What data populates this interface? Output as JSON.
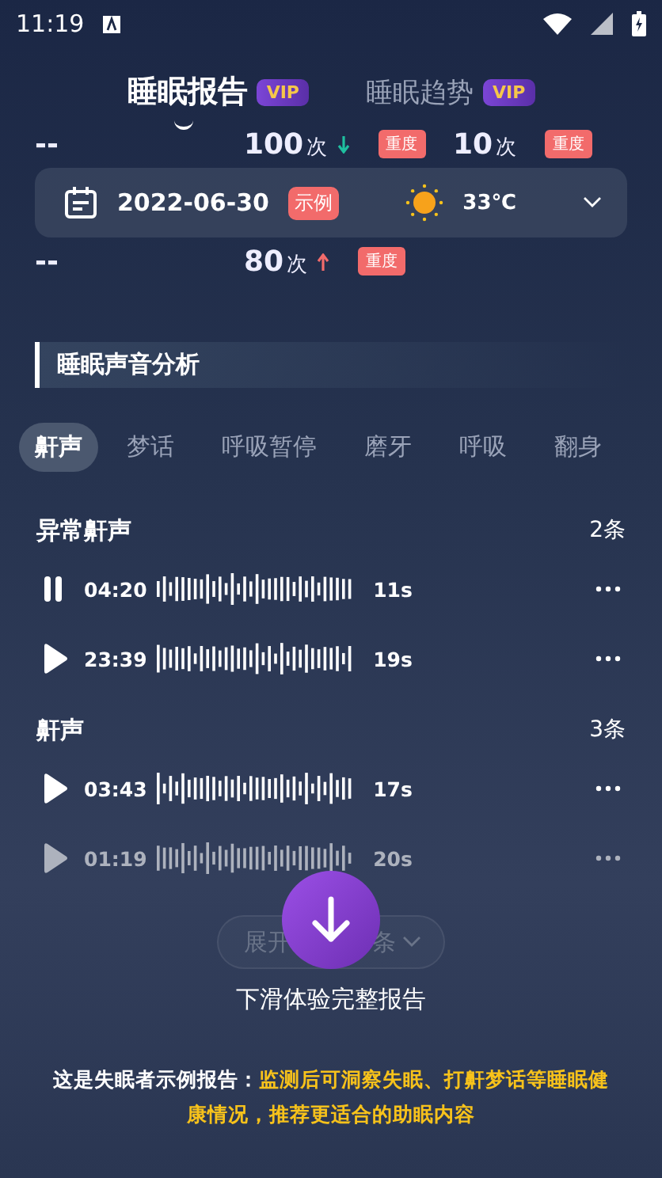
{
  "status_bar": {
    "time": "11:19"
  },
  "tabs": [
    {
      "label": "睡眠报告",
      "badge": "VIP",
      "selected": true
    },
    {
      "label": "睡眠趋势",
      "badge": "VIP",
      "selected": false
    }
  ],
  "stats_rows": [
    {
      "cells": [
        {
          "value": "--"
        },
        {
          "value": "100",
          "unit": "次",
          "increase": false,
          "severity": "重度"
        },
        {
          "value": "10",
          "unit": "次",
          "severity": "重度"
        }
      ]
    },
    {
      "cells": [
        {
          "value": "--"
        },
        {
          "value": "80",
          "unit": "次",
          "increase": true,
          "severity": "重度"
        }
      ]
    }
  ],
  "date_bar": {
    "date": "2022-06-30",
    "tag": "示例",
    "temperature": "33℃"
  },
  "section_title": "睡眠声音分析",
  "categories": [
    {
      "label": "鼾声",
      "selected": true
    },
    {
      "label": "梦话",
      "selected": false
    },
    {
      "label": "呼吸暂停",
      "selected": false
    },
    {
      "label": "磨牙",
      "selected": false
    },
    {
      "label": "呼吸",
      "selected": false
    },
    {
      "label": "翻身",
      "selected": false
    }
  ],
  "groups": [
    {
      "title": "异常鼾声",
      "count": "2条",
      "recordings": [
        {
          "time": "04:20",
          "duration": "11s",
          "playing": true,
          "dimmed": false
        },
        {
          "time": "23:39",
          "duration": "19s",
          "playing": false,
          "dimmed": false
        }
      ]
    },
    {
      "title": "鼾声",
      "count": "3条",
      "recordings": [
        {
          "time": "03:43",
          "duration": "17s",
          "playing": false,
          "dimmed": false
        },
        {
          "time": "01:19",
          "duration": "20s",
          "playing": false,
          "dimmed": true
        }
      ]
    }
  ],
  "expand_button": {
    "parts": [
      "展开",
      "条"
    ]
  },
  "swipe_hint": "下滑体验完整报告",
  "footer": {
    "lead": "这是失眠者示例报告：",
    "highlight": "监测后可洞察失眠、打鼾梦话等睡眠健康情况，推荐更适合的助眠内容"
  }
}
